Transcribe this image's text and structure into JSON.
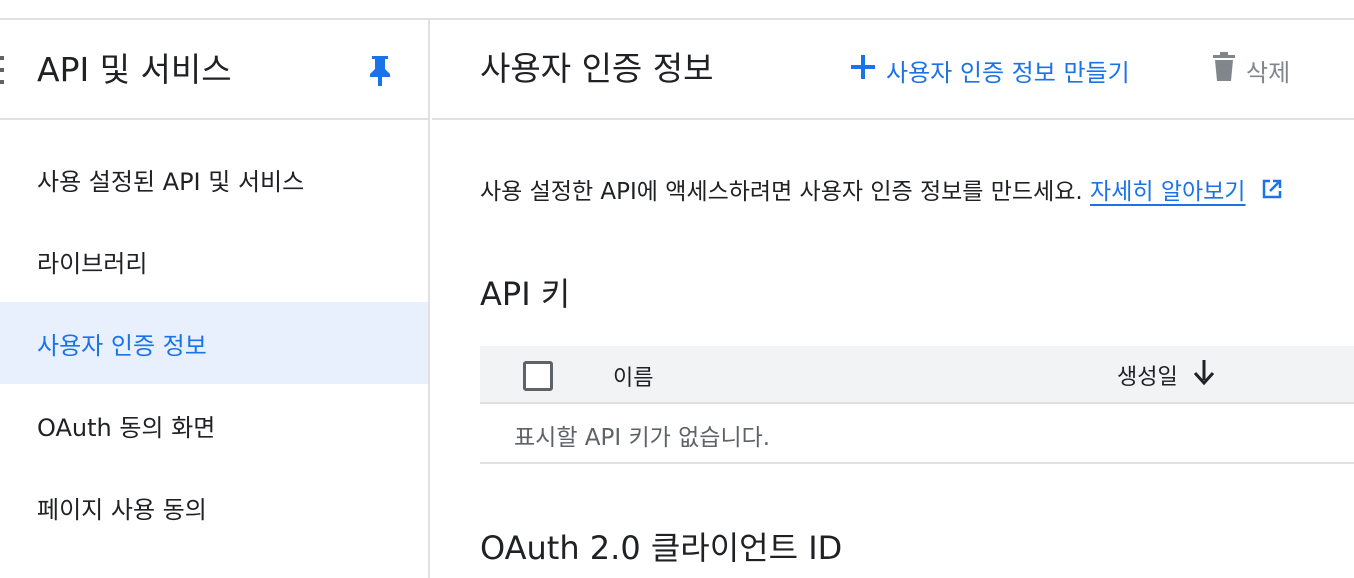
{
  "sidebar": {
    "title": "API 및 서비스",
    "items": [
      {
        "label": "사용 설정된 API 및 서비스",
        "active": false
      },
      {
        "label": "라이브러리",
        "active": false
      },
      {
        "label": "사용자 인증 정보",
        "active": true
      },
      {
        "label": "OAuth 동의 화면",
        "active": false
      },
      {
        "label": "페이지 사용 동의",
        "active": false
      }
    ]
  },
  "header": {
    "title": "사용자 인증 정보",
    "create_label": "사용자 인증 정보 만들기",
    "delete_label": "삭제"
  },
  "main": {
    "intro_text": "사용 설정한 API에 액세스하려면 사용자 인증 정보를 만드세요.",
    "learn_more": "자세히 알아보기",
    "api_keys": {
      "title": "API 키",
      "columns": {
        "name": "이름",
        "created": "생성일"
      },
      "empty_text": "표시할 API 키가 없습니다."
    },
    "oauth_title": "OAuth 2.0 클라이언트 ID"
  },
  "icons": {
    "pin": "pin-icon",
    "add": "plus-icon",
    "delete": "trash-icon",
    "external": "external-link-icon",
    "sort": "arrow-down-icon"
  },
  "colors": {
    "accent": "#1a73e8",
    "active_bg": "#e8f0fe",
    "table_header_bg": "#f1f3f4",
    "muted": "#5f6368"
  }
}
